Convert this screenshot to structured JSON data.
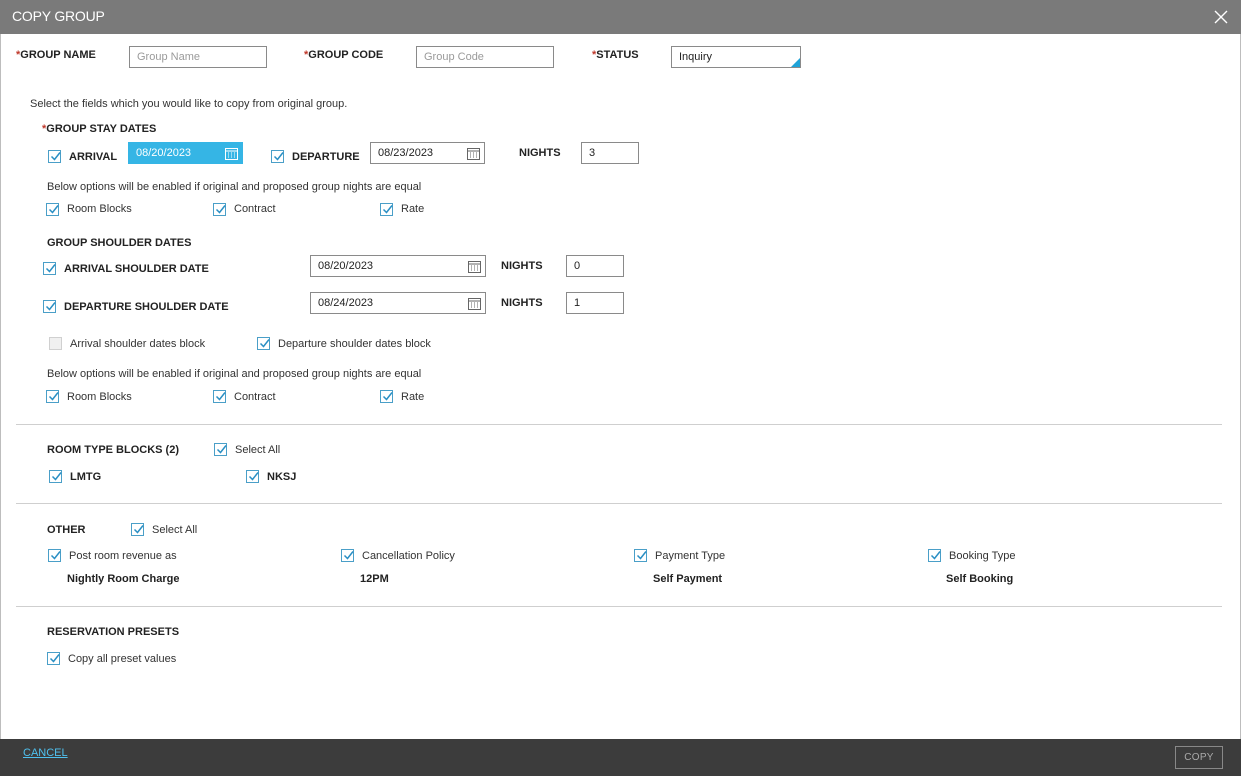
{
  "dialog": {
    "title": "COPY GROUP"
  },
  "header": {
    "group_name_label": "GROUP NAME",
    "group_name_placeholder": "Group Name",
    "group_code_label": "GROUP CODE",
    "group_code_placeholder": "Group Code",
    "status_label": "STATUS",
    "status_value": "Inquiry",
    "required_mark": "*"
  },
  "intro_text": "Select the fields which you would like to copy from original group.",
  "stay_dates": {
    "title": "GROUP STAY DATES",
    "arrival_label": "ARRIVAL",
    "arrival_value": "08/20/2023",
    "departure_label": "DEPARTURE",
    "departure_value": "08/23/2023",
    "nights_label": "NIGHTS",
    "nights_value": "3",
    "note": "Below options will be enabled if original and proposed group nights are equal",
    "options": [
      "Room Blocks",
      "Contract",
      "Rate"
    ]
  },
  "shoulder_dates": {
    "title": "GROUP SHOULDER DATES",
    "arrival_label": "ARRIVAL SHOULDER DATE",
    "arrival_value": "08/20/2023",
    "arrival_nights_label": "NIGHTS",
    "arrival_nights_value": "0",
    "departure_label": "DEPARTURE SHOULDER DATE",
    "departure_value": "08/24/2023",
    "departure_nights_label": "NIGHTS",
    "departure_nights_value": "1",
    "arrival_block_label": "Arrival shoulder dates block",
    "departure_block_label": "Departure shoulder dates block",
    "note": "Below options will be enabled if original and proposed group nights are equal",
    "options": [
      "Room Blocks",
      "Contract",
      "Rate"
    ]
  },
  "room_type_blocks": {
    "title": "ROOM TYPE BLOCKS (2)",
    "select_all_label": "Select All",
    "items": [
      "LMTG",
      "NKSJ"
    ]
  },
  "other": {
    "title": "OTHER",
    "select_all_label": "Select All",
    "items": [
      {
        "label": "Post room revenue as",
        "value": "Nightly Room Charge"
      },
      {
        "label": "Cancellation Policy",
        "value": "12PM"
      },
      {
        "label": "Payment Type",
        "value": "Self Payment"
      },
      {
        "label": "Booking Type",
        "value": "Self Booking"
      }
    ]
  },
  "reservation_presets": {
    "title": "RESERVATION PRESETS",
    "copy_all_label": "Copy all preset values"
  },
  "footer": {
    "cancel_label": "CANCEL",
    "copy_label": "COPY"
  },
  "colors": {
    "accent": "#35b5e5",
    "titlebar": "#7a7a7a",
    "footer": "#3c3c3c",
    "required": "#c0392b"
  },
  "icons": [
    "close-icon",
    "calendar-icon",
    "checkmark-icon",
    "dropdown-corner-icon"
  ]
}
